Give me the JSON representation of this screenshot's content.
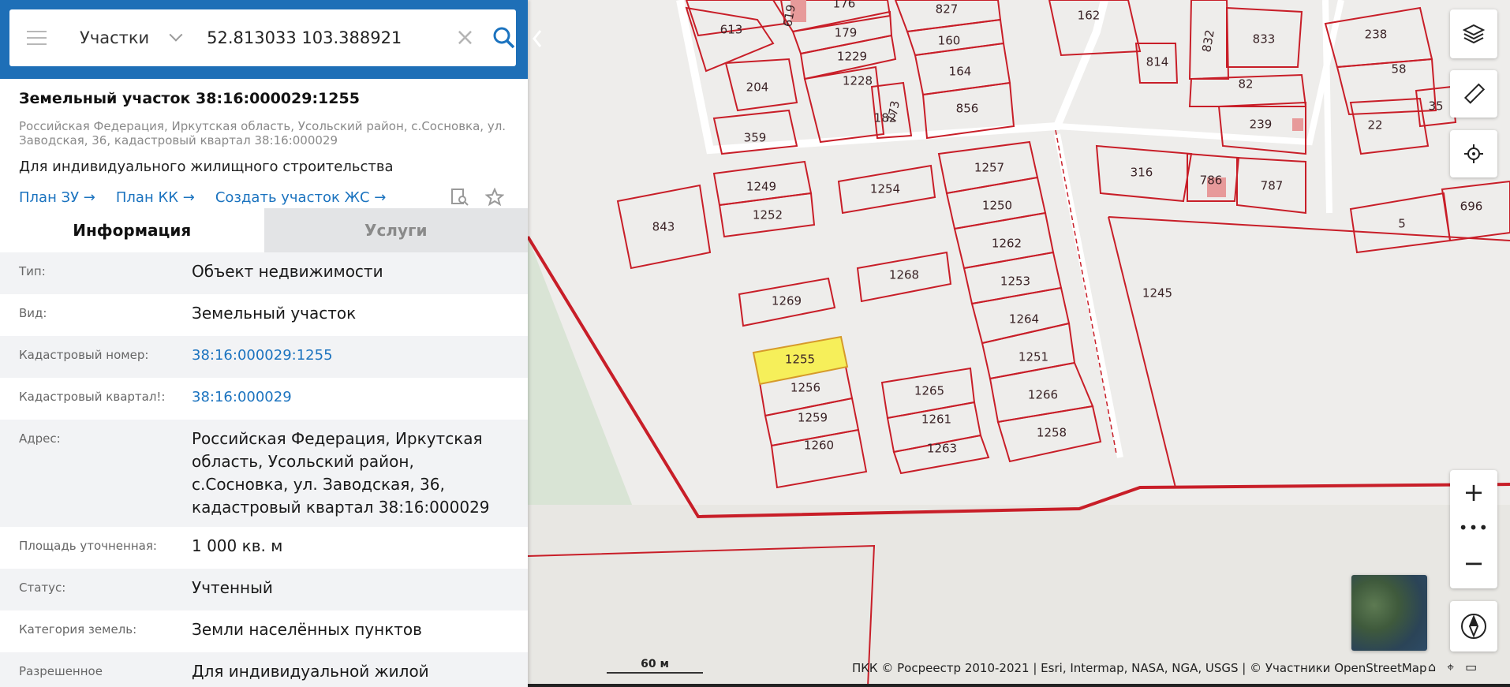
{
  "search": {
    "layer": "Участки",
    "query": "52.813033 103.388921"
  },
  "object": {
    "title": "Земельный участок 38:16:000029:1255",
    "address_short": "Российская Федерация, Иркутская область, Усольский район, с.Сосновка, ул. Заводская, 36, кадастровый квартал 38:16:000029",
    "purpose": "Для индивидуального жилищного строительства",
    "links": [
      "План ЗУ",
      "План КК",
      "Создать участок ЖС"
    ]
  },
  "tabs": [
    "Информация",
    "Услуги"
  ],
  "props": [
    {
      "k": "Тип:",
      "v": "Объект недвижимости"
    },
    {
      "k": "Вид:",
      "v": "Земельный участок"
    },
    {
      "k": "Кадастровый номер:",
      "v": "38:16:000029:1255"
    },
    {
      "k": "Кадастровый квартал!:",
      "v": "38:16:000029"
    },
    {
      "k": "Адрес:",
      "v": "Российская Федерация, Иркутская область, Усольский район, с.Сосновка, ул. Заводская, 36, кадастровый квартал 38:16:000029"
    },
    {
      "k": "Площадь уточненная:",
      "v": "1 000 кв. м"
    },
    {
      "k": "Статус:",
      "v": "Учтенный"
    },
    {
      "k": "Категория земель:",
      "v": "Земли населённых пунктов"
    },
    {
      "k": "Разрешенное",
      "v": "Для индивидуальной жилой застройки"
    }
  ],
  "map": {
    "scale": "60 м",
    "attribution": "ПКК © Росреестр 2010-2021 | Esri, Intermap, NASA, NGA, USGS | © Участники OpenStreetMap",
    "parcels": [
      "613",
      "204",
      "359",
      "176",
      "179",
      "1229",
      "1228",
      "182",
      "773",
      "827",
      "160",
      "164",
      "856",
      "162",
      "814",
      "832",
      "833",
      "82",
      "239",
      "238",
      "58",
      "35",
      "22",
      "1249",
      "1252",
      "1254",
      "1257",
      "1250",
      "1262",
      "1253",
      "1264",
      "1251",
      "1266",
      "1258",
      "843",
      "1269",
      "1268",
      "1255",
      "1256",
      "1259",
      "1260",
      "1265",
      "1261",
      "1263",
      "316",
      "786",
      "787",
      "1245",
      "5",
      "696",
      "619"
    ],
    "colors": {
      "boundary": "#c81e28",
      "selected_fill": "#f6ef5a",
      "panel_accent": "#1e6fb7"
    }
  }
}
